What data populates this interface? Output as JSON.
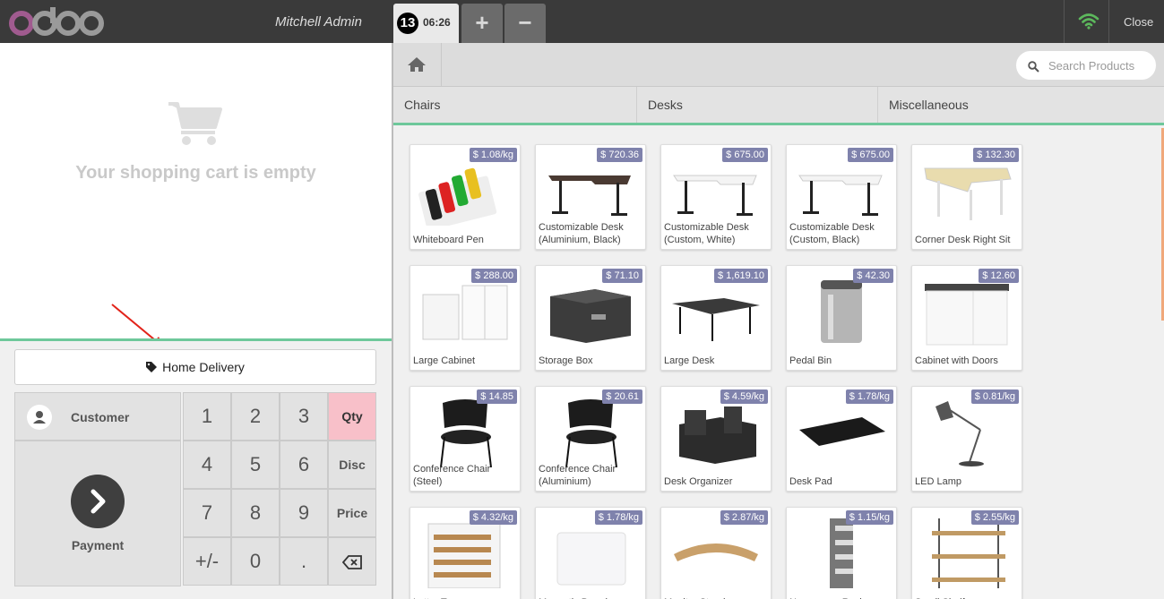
{
  "header": {
    "logo_text": "odoo",
    "cashier": "Mitchell Admin",
    "order": {
      "number": "13",
      "time": "06:26"
    },
    "add_order_label": "+",
    "remove_order_label": "−",
    "close_label": "Close",
    "wifi_color": "#5cb85c"
  },
  "cart": {
    "empty_message": "Your shopping cart is empty"
  },
  "controls": {
    "home_delivery_label": "Home Delivery",
    "customer_label": "Customer",
    "payment_label": "Payment",
    "numpad": [
      "1",
      "2",
      "3",
      "4",
      "5",
      "6",
      "7",
      "8",
      "9",
      "+/-",
      "0",
      "."
    ],
    "modes": {
      "qty": "Qty",
      "disc": "Disc",
      "price": "Price",
      "backspace": "⌫"
    },
    "active_mode": "Qty",
    "accent_color": "#6ec89b"
  },
  "search": {
    "placeholder": "Search Products"
  },
  "categories": [
    "Chairs",
    "Desks",
    "Miscellaneous"
  ],
  "products": [
    {
      "name": "Whiteboard Pen",
      "price": "$ 1.08/kg",
      "icon": "pens"
    },
    {
      "name": "Customizable Desk (Aluminium, Black)",
      "price": "$ 720.36",
      "icon": "desk-dark"
    },
    {
      "name": "Customizable Desk (Custom, White)",
      "price": "$ 675.00",
      "icon": "desk-white"
    },
    {
      "name": "Customizable Desk (Custom, Black)",
      "price": "$ 675.00",
      "icon": "desk-white"
    },
    {
      "name": "Corner Desk Right Sit",
      "price": "$ 132.30",
      "icon": "desk-corner"
    },
    {
      "name": "Large Cabinet",
      "price": "$ 288.00",
      "icon": "cabinet-white"
    },
    {
      "name": "Storage Box",
      "price": "$ 71.10",
      "icon": "storage-box"
    },
    {
      "name": "Large Desk",
      "price": "$ 1,619.10",
      "icon": "large-desk"
    },
    {
      "name": "Pedal Bin",
      "price": "$ 42.30",
      "icon": "pedal-bin"
    },
    {
      "name": "Cabinet with Doors",
      "price": "$ 12.60",
      "icon": "cabinet-doors"
    },
    {
      "name": "Conference Chair (Steel)",
      "price": "$ 14.85",
      "icon": "chair"
    },
    {
      "name": "Conference Chair (Aluminium)",
      "price": "$ 20.61",
      "icon": "chair"
    },
    {
      "name": "Desk Organizer",
      "price": "$ 4.59/kg",
      "icon": "organizer"
    },
    {
      "name": "Desk Pad",
      "price": "$ 1.78/kg",
      "icon": "desk-pad"
    },
    {
      "name": "LED Lamp",
      "price": "$ 0.81/kg",
      "icon": "lamp"
    },
    {
      "name": "Letter Tray",
      "price": "$ 4.32/kg",
      "icon": "letter-tray"
    },
    {
      "name": "Magnetic Board",
      "price": "$ 1.78/kg",
      "icon": "board"
    },
    {
      "name": "Monitor Stand",
      "price": "$ 2.87/kg",
      "icon": "monitor-stand"
    },
    {
      "name": "Newspaper Rack",
      "price": "$ 1.15/kg",
      "icon": "rack"
    },
    {
      "name": "Small Shelf",
      "price": "$ 2.55/kg",
      "icon": "shelf"
    }
  ]
}
